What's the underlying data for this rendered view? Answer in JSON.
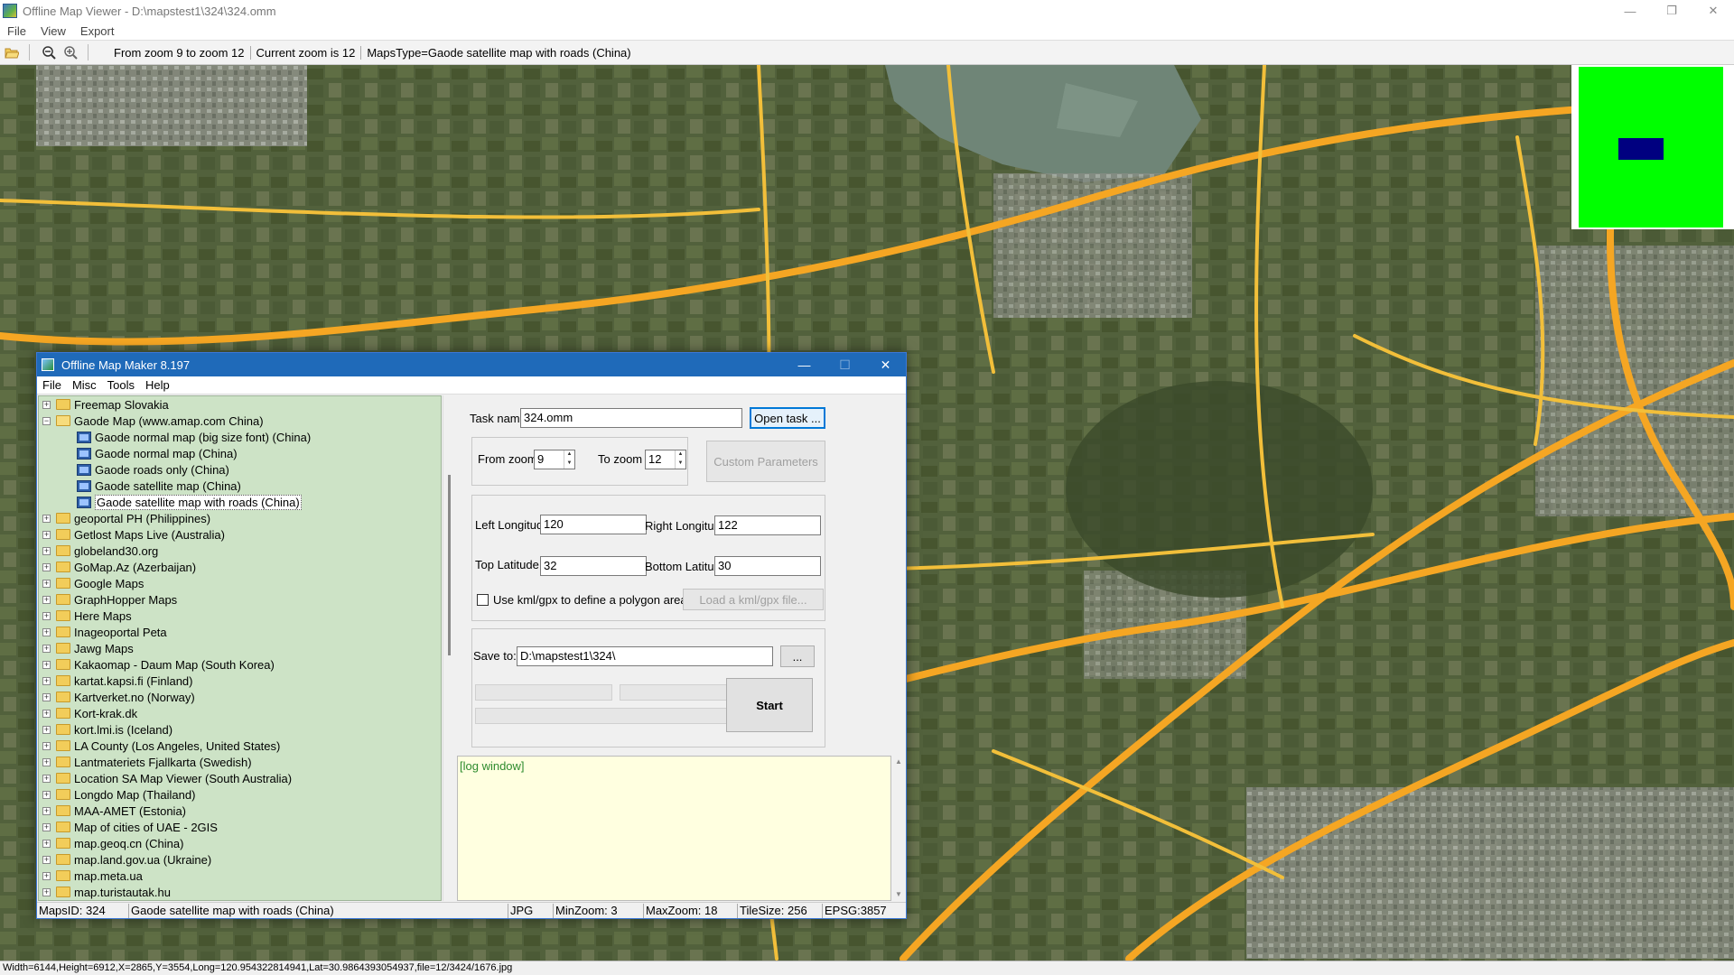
{
  "window": {
    "title": "Offline Map Viewer - D:\\mapstest1\\324\\324.omm",
    "minimize": "—",
    "maximize": "❐",
    "close": "✕"
  },
  "menu": [
    "File",
    "View",
    "Export"
  ],
  "toolbar": {
    "zoom_range": "From zoom 9 to zoom 12",
    "current_zoom": "Current zoom is 12",
    "maps_type": "MapsType=Gaode satellite map with roads (China)"
  },
  "status_bar": "Width=6144,Height=6912,X=2865,Y=3554,Long=120.954322814941,Lat=30.9864393054937,file=12/3424/1676.jpg",
  "dialog": {
    "title": "Offline Map Maker 8.197",
    "minimize": "—",
    "maximize": "☐",
    "close": "✕",
    "menu": [
      "File",
      "Misc",
      "Tools",
      "Help"
    ],
    "tree": [
      {
        "label": "Freemap Slovakia",
        "expanded": false
      },
      {
        "label": "Gaode Map (www.amap.com China)",
        "expanded": true,
        "children": [
          "Gaode normal map (big size font) (China)",
          "Gaode normal map (China)",
          "Gaode roads only (China)",
          "Gaode satellite map (China)",
          "Gaode satellite map with roads (China)"
        ],
        "selected_child": 4
      },
      {
        "label": "geoportal PH (Philippines)"
      },
      {
        "label": "Getlost Maps Live (Australia)"
      },
      {
        "label": "globeland30.org"
      },
      {
        "label": "GoMap.Az (Azerbaijan)"
      },
      {
        "label": "Google Maps"
      },
      {
        "label": "GraphHopper Maps"
      },
      {
        "label": "Here Maps"
      },
      {
        "label": "Inageoportal Peta"
      },
      {
        "label": "Jawg Maps"
      },
      {
        "label": "Kakaomap - Daum Map (South Korea)"
      },
      {
        "label": "kartat.kapsi.fi (Finland)"
      },
      {
        "label": "Kartverket.no (Norway)"
      },
      {
        "label": "Kort-krak.dk"
      },
      {
        "label": "kort.lmi.is (Iceland)"
      },
      {
        "label": "LA County (Los Angeles, United States)"
      },
      {
        "label": "Lantmateriets Fjallkarta (Swedish)"
      },
      {
        "label": "Location SA Map Viewer (South Australia)"
      },
      {
        "label": "Longdo Map (Thailand)"
      },
      {
        "label": "MAA-AMET (Estonia)"
      },
      {
        "label": "Map of cities of UAE - 2GIS"
      },
      {
        "label": "map.geoq.cn (China)"
      },
      {
        "label": "map.land.gov.ua (Ukraine)"
      },
      {
        "label": "map.meta.ua"
      },
      {
        "label": "map.turistautak.hu"
      }
    ],
    "task_name_label": "Task name",
    "task_name_value": "324.omm",
    "open_task_button": "Open task ...",
    "from_zoom_label": "From zoom",
    "from_zoom_value": "9",
    "to_zoom_label": "To zoom",
    "to_zoom_value": "12",
    "custom_parameters_button": "Custom Parameters",
    "left_longitude_label": "Left Longitude",
    "left_longitude_value": "120",
    "right_longitude_label": "Right Longitude",
    "right_longitude_value": "122",
    "top_latitude_label": "Top Latitude",
    "top_latitude_value": "32",
    "bottom_latitude_label": "Bottom Latitude",
    "bottom_latitude_value": "30",
    "use_kml_label": "Use kml/gpx to define a polygon area",
    "load_kml_button": "Load a kml/gpx file...",
    "save_to_label": "Save to:",
    "save_to_value": "D:\\mapstest1\\324\\",
    "browse_button": "...",
    "start_button": "Start",
    "log_text": "[log window]",
    "status": {
      "maps_id": "MapsID: 324",
      "map_name": "Gaode satellite map with roads (China)",
      "format": "JPG",
      "min_zoom": "MinZoom: 3",
      "max_zoom": "MaxZoom: 18",
      "tile_size": "TileSize: 256",
      "epsg": "EPSG:3857"
    }
  },
  "colors": {
    "tree_bg": "#cde3c6",
    "dialog_title_bg": "#1f6ab9",
    "log_bg": "#ffffe0",
    "minimap_green": "#00ff00",
    "minimap_rect": "#000080",
    "road_orange": "#f5a623"
  }
}
